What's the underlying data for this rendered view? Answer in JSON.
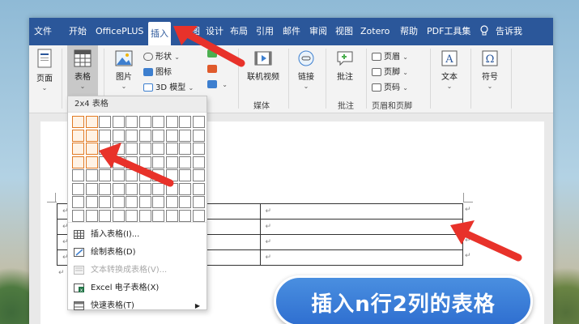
{
  "menu": {
    "items": [
      "文件",
      "开始",
      "OfficePLUS",
      "插入",
      "绘图",
      "设计",
      "布局",
      "引用",
      "邮件",
      "审阅",
      "视图",
      "Zotero",
      "帮助",
      "PDF工具集",
      "告诉我"
    ],
    "active": "插入"
  },
  "ribbon": {
    "page_label": "页面",
    "table_label": "表格",
    "picture_label": "图片",
    "shapes_label": "形状",
    "icons_label": "图标",
    "model3d_label": "3D 模型",
    "online_video_label": "联机视频",
    "media_group": "媒体",
    "link_label": "链接",
    "comment_label": "批注",
    "comment_group": "批注",
    "header_label": "页眉",
    "footer_label": "页脚",
    "pagenum_label": "页码",
    "header_footer_group": "页眉和页脚",
    "text_label": "文本",
    "symbol_label": "符号"
  },
  "dropdown": {
    "header": "2x4 表格",
    "grid_cols": 10,
    "grid_rows": 8,
    "highlight_cols": 2,
    "highlight_rows": 4,
    "items": [
      {
        "label": "插入表格(I)...",
        "icon": "insert-table-icon",
        "enabled": true
      },
      {
        "label": "绘制表格(D)",
        "icon": "draw-table-icon",
        "enabled": true
      },
      {
        "label": "文本转换成表格(V)...",
        "icon": "text-to-table-icon",
        "enabled": false
      },
      {
        "label": "Excel 电子表格(X)",
        "icon": "excel-icon",
        "enabled": true
      },
      {
        "label": "快速表格(T)",
        "icon": "quick-table-icon",
        "enabled": true,
        "submenu": true
      }
    ]
  },
  "document": {
    "return_mark": "↵"
  },
  "banner": {
    "text": "插入n行2列的表格"
  },
  "colors": {
    "menubar": "#2b579a",
    "highlight": "#e07a24",
    "arrow": "#e8322a",
    "banner": "#3a7ed8"
  }
}
